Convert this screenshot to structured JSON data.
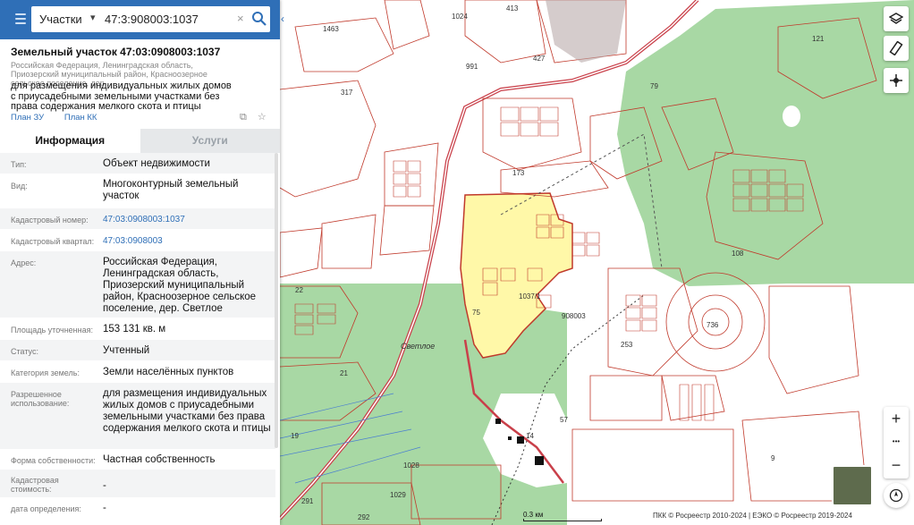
{
  "search": {
    "type_label": "Участки",
    "value": "47:3:908003:1037"
  },
  "header": {
    "title": "Земельный участок 47:03:0908003:1037",
    "address_small": "Российская Федерация, Ленинградская область, Приозерский муниципальный район, Красноозерное сельское поселение, дер...",
    "purpose": "для размещения индивидуальных жилых домов с приусадебными земельными участками без права содержания мелкого скота и птицы",
    "link_plan_zu": "План ЗУ",
    "link_plan_kk": "План КК"
  },
  "tabs": [
    {
      "label": "Информация",
      "active": true
    },
    {
      "label": "Услуги",
      "active": false
    }
  ],
  "rows": [
    {
      "label": "Тип:",
      "value": "Объект недвижимости"
    },
    {
      "label": "Вид:",
      "value": "Многоконтурный земельный участок"
    },
    {
      "label": "Кадастровый номер:",
      "value": "47:03:0908003:1037"
    },
    {
      "label": "Кадастровый квартал:",
      "value": "47:03:0908003"
    },
    {
      "label": "Адрес:",
      "value": "Российская Федерация, Ленинградская область, Приозерский муниципальный район, Красноозерное сельское поселение, дер. Светлое"
    },
    {
      "label": "Площадь уточненная:",
      "value": "153 131 кв. м"
    },
    {
      "label": "Статус:",
      "value": "Учтенный"
    },
    {
      "label": "Категория земель:",
      "value": "Земли населённых пунктов"
    },
    {
      "label": "Разрешенное использование:",
      "value": "для размещения индивидуальных жилых домов с приусадебными земельными участками без права содержания мелкого скота и птицы"
    },
    {
      "label": "Форма собственности:",
      "value": "Частная собственность"
    },
    {
      "label": "Кадастровая стоимость:",
      "value": "-"
    },
    {
      "label": "дата определения:",
      "value": "-"
    }
  ],
  "map": {
    "labels": {
      "svetloe": "Светлое",
      "parcel_label": "1037/1",
      "quarter_label": "908003",
      "l75": "75",
      "l14": "14",
      "l108": "108",
      "l121": "121",
      "l1024": "1024",
      "l1463": "1463",
      "l317": "317",
      "l22": "22",
      "l21": "21",
      "l19": "19",
      "l1028": "1028",
      "l1029": "1029",
      "l291": "291",
      "l292": "292",
      "l9": "9",
      "l253": "253",
      "l413": "413",
      "l427": "427",
      "l991": "991",
      "l173": "173",
      "l79": "79",
      "l736": "736",
      "l57": "57"
    },
    "scale_label": "0.3 км",
    "copyright": "ПКК © Росреестр 2010-2024 | ЕЭКО © Росреестр 2019-2024",
    "colors": {
      "forest": "#a8d8a4",
      "parcel": "#fff8a8",
      "boundary": "#c0392b",
      "road": "#c9404a"
    }
  },
  "controls": {
    "zoom_in": "+",
    "zoom_more": "•••",
    "zoom_out": "−"
  }
}
